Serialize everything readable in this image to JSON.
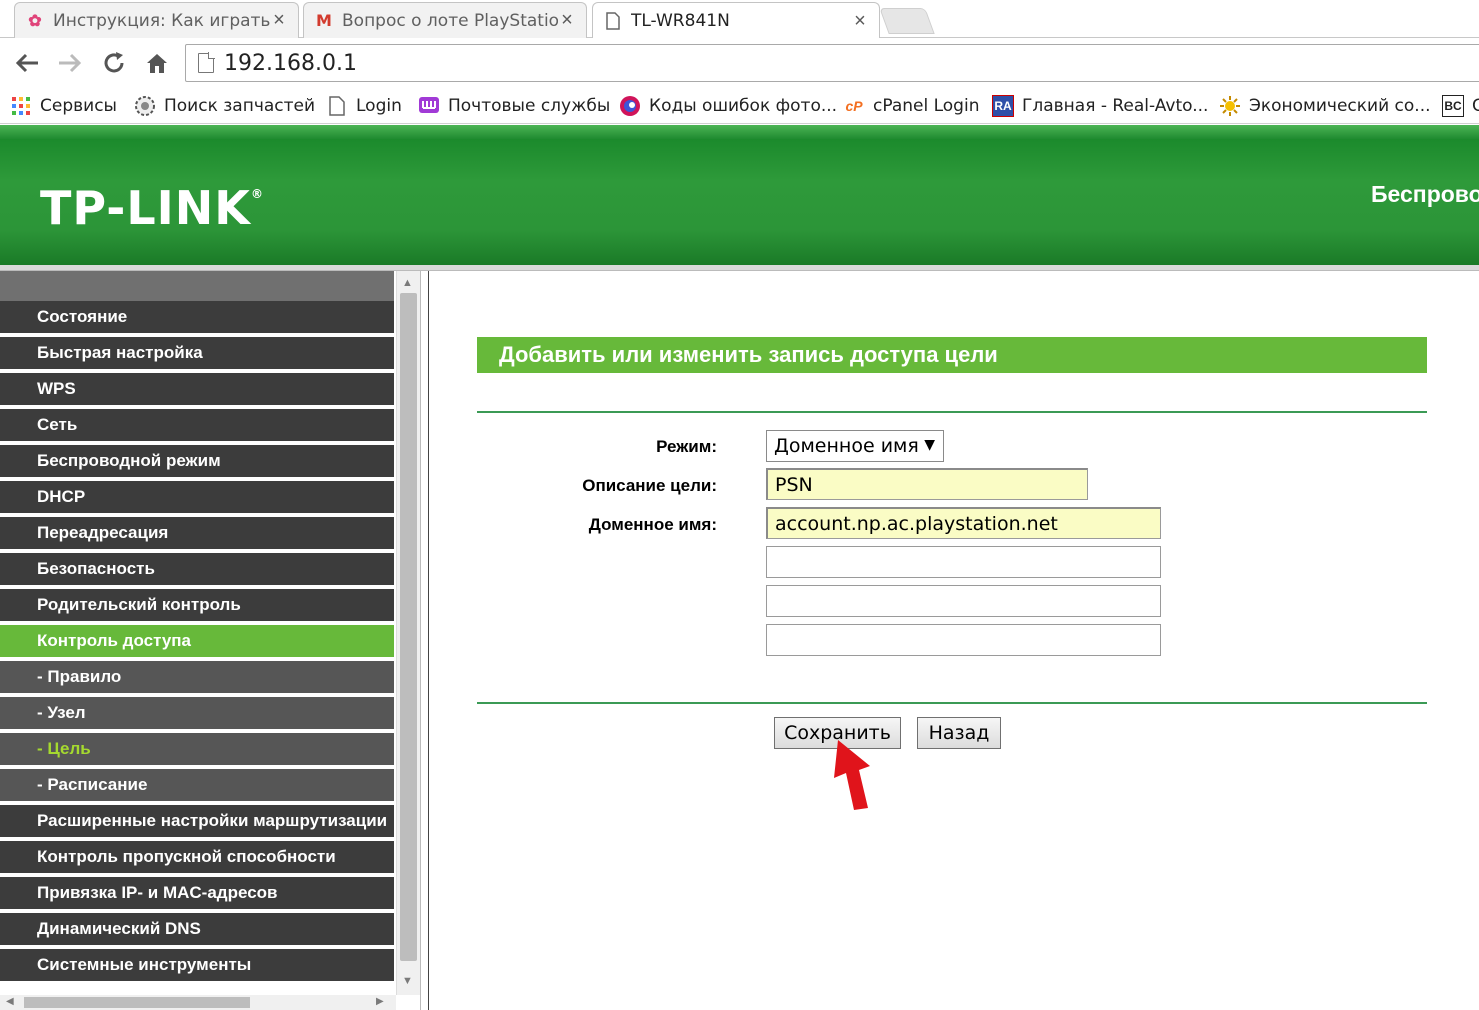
{
  "browser": {
    "tabs": [
      {
        "title": "Инструкция: Как играть н",
        "icon": "pinwheel-icon",
        "active": false
      },
      {
        "title": "Вопрос о лоте PlayStation",
        "icon": "gmail-icon",
        "active": false
      },
      {
        "title": "TL-WR841N",
        "icon": "page-icon",
        "active": true
      }
    ],
    "close_glyph": "×",
    "url": "192.168.0.1",
    "bookmarks": [
      {
        "label": "Сервисы",
        "icon": "apps-grid-icon"
      },
      {
        "label": "Поиск запчастей",
        "icon": "gear-icon"
      },
      {
        "label": "Login",
        "icon": "page-icon"
      },
      {
        "label": "Почтовые службы",
        "icon": "mail-service-icon"
      },
      {
        "label": "Коды ошибок фото...",
        "icon": "colorful-circle-icon"
      },
      {
        "label": "cPanel Login",
        "icon": "cpanel-icon"
      },
      {
        "label": "Главная - Real-Avto...",
        "icon": "ra-logo-icon"
      },
      {
        "label": "Экономический со...",
        "icon": "sun-icon"
      },
      {
        "label": "C",
        "icon": "bc-logo-icon"
      }
    ],
    "bookmark_badges": {
      "ra": "RA",
      "bc": "BC",
      "cpanel": "cP"
    }
  },
  "router": {
    "logo": "TP-LINK",
    "logo_mark": "®",
    "banner_right": "Беспрово",
    "menu": [
      {
        "label": "Состояние",
        "type": "main"
      },
      {
        "label": "Быстрая настройка",
        "type": "main"
      },
      {
        "label": "WPS",
        "type": "main"
      },
      {
        "label": "Сеть",
        "type": "main"
      },
      {
        "label": "Беспроводной режим",
        "type": "main"
      },
      {
        "label": "DHCP",
        "type": "main"
      },
      {
        "label": "Переадресация",
        "type": "main"
      },
      {
        "label": "Безопасность",
        "type": "main"
      },
      {
        "label": "Родительский контроль",
        "type": "main"
      },
      {
        "label": "Контроль доступа",
        "type": "active"
      },
      {
        "label": "- Правило",
        "type": "sub"
      },
      {
        "label": "- Узел",
        "type": "sub"
      },
      {
        "label": "- Цель",
        "type": "current"
      },
      {
        "label": "- Расписание",
        "type": "sub"
      },
      {
        "label": "Расширенные настройки маршрутизации",
        "type": "main"
      },
      {
        "label": "Контроль пропускной способности",
        "type": "main"
      },
      {
        "label": "Привязка IP- и MAC-адресов",
        "type": "main"
      },
      {
        "label": "Динамический DNS",
        "type": "main"
      },
      {
        "label": "Системные инструменты",
        "type": "main"
      }
    ],
    "section_title": "Добавить или изменить запись доступа цели",
    "form": {
      "mode_label": "Режим:",
      "mode_value": "Доменное имя",
      "mode_arrow": "▼",
      "description_label": "Описание цели:",
      "description_value": "PSN",
      "domain_label": "Доменное имя:",
      "domain_values": [
        "account.np.ac.playstation.net",
        "",
        "",
        ""
      ]
    },
    "buttons": {
      "save": "Сохранить",
      "back": "Назад"
    },
    "highlight_color": "#67b93a",
    "arrow_color": "#e0141b"
  }
}
